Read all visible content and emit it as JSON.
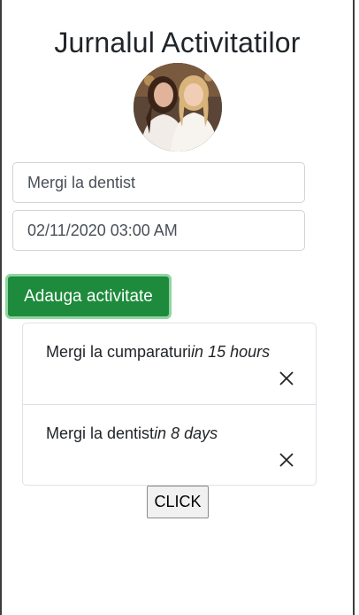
{
  "page": {
    "title": "Jurnalul Activitatilor"
  },
  "form": {
    "name_value": "Mergi la dentist",
    "date_value": "02/11/2020 03:00 AM",
    "add_label": "Adauga activitate"
  },
  "activities": [
    {
      "text": "Mergi la cumparaturi",
      "time": "in 15 hours",
      "remove_icon": "close-icon"
    },
    {
      "text": "Mergi la dentist",
      "time": "in 8 days",
      "remove_icon": "close-icon"
    }
  ],
  "click_label": "CLICK",
  "colors": {
    "add_button": "#1e8a3c",
    "add_button_focus_ring": "#8fd4a1",
    "border": "#dee2e6"
  }
}
